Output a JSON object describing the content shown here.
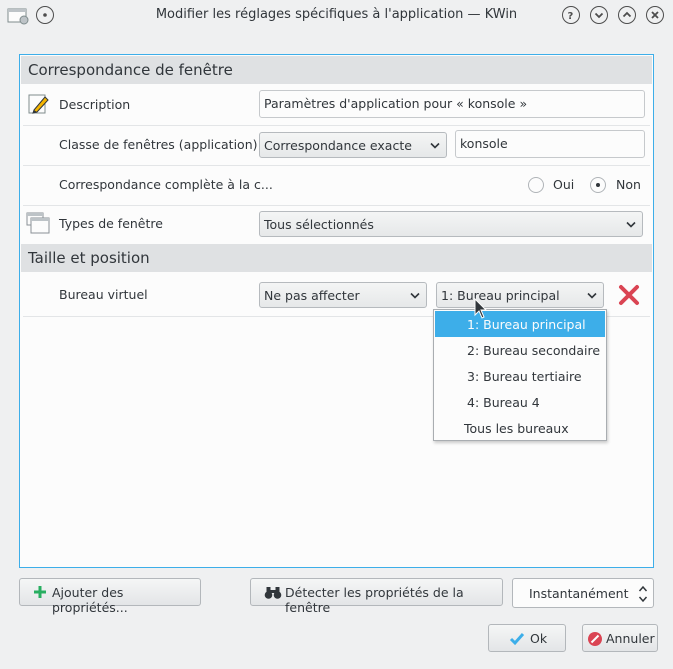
{
  "window": {
    "title": "Modifier les réglages spécifiques à l'application — KWin"
  },
  "sections": {
    "matching": "Correspondance de fenêtre",
    "size_position": "Taille et position"
  },
  "rows": {
    "description": {
      "label": "Description",
      "value": "Paramètres d'application pour « konsole »"
    },
    "window_class": {
      "label": "Classe de fenêtres (application)",
      "match_mode": "Correspondance exacte",
      "value": "konsole"
    },
    "full_match": {
      "label": "Correspondance complète à la c...",
      "yes": "Oui",
      "no": "Non",
      "selected": "no"
    },
    "window_types": {
      "label": "Types de fenêtre",
      "value": "Tous sélectionnés"
    },
    "virtual_desktop": {
      "label": "Bureau virtuel",
      "policy": "Ne pas affecter",
      "value": "1: Bureau principal"
    }
  },
  "dropdown": {
    "items": [
      "1: Bureau principal",
      "2: Bureau secondaire",
      "3: Bureau tertiaire",
      "4: Bureau 4",
      "Tous les bureaux"
    ],
    "selected_index": 0
  },
  "bottom": {
    "add_label": "Ajouter des propriétés...",
    "detect_label": "Détecter les propriétés de la fenêtre",
    "detect_mode": "Instantanément"
  },
  "dialog": {
    "ok_label": "Ok",
    "cancel_label": "Annuler"
  },
  "icons": {
    "description": "pencil-icon",
    "types": "windows-icon",
    "remove": "red-x-icon",
    "add": "plus-icon",
    "detect": "binoculars-icon",
    "ok": "checkmark-icon",
    "cancel": "cancel-icon"
  },
  "colors": {
    "accent": "#3daee9",
    "remove": "#da4453",
    "add": "#27ae60"
  }
}
